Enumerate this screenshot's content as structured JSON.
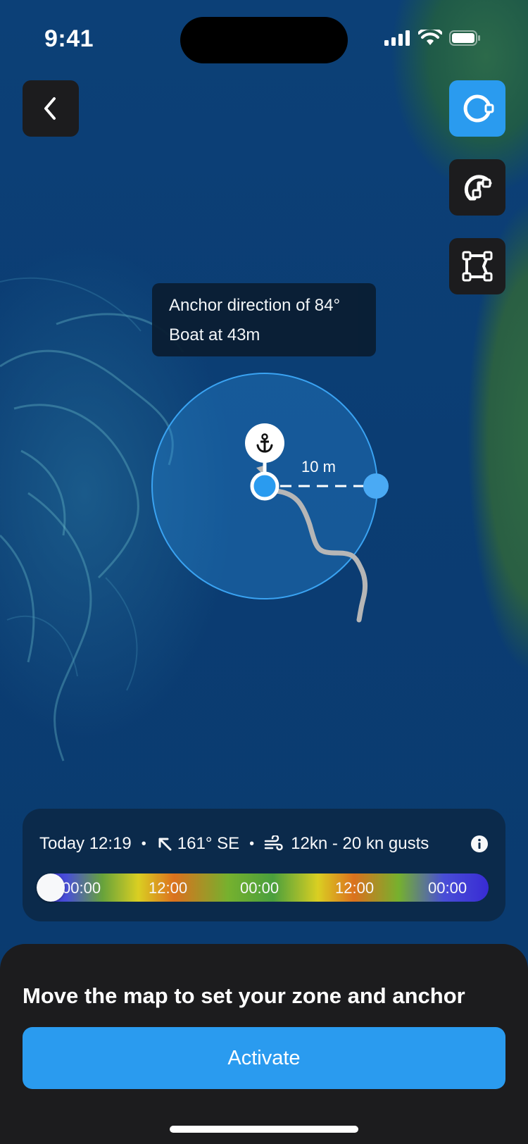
{
  "status_bar": {
    "time": "9:41"
  },
  "toolbar": {
    "back_icon": "chevron-left-icon",
    "tools": [
      {
        "name": "circle-zone-tool",
        "icon": "circle-zone-icon",
        "active": true
      },
      {
        "name": "sector-zone-tool",
        "icon": "sector-zone-icon",
        "active": false
      },
      {
        "name": "polygon-zone-tool",
        "icon": "polygon-zone-icon",
        "active": false
      }
    ]
  },
  "map": {
    "tooltip": {
      "line1": "Anchor direction of 84°",
      "line2": "Boat at 43m"
    },
    "radius_label": "10 m",
    "anchor_icon": "anchor-icon"
  },
  "weather": {
    "date_time": "Today 12:19",
    "wind_direction": "161° SE",
    "wind_speed": "12kn - 20 kn gusts",
    "timeline_ticks": [
      "00:00",
      "12:00",
      "00:00",
      "12:00",
      "00:00"
    ],
    "timeline_position": 0
  },
  "sheet": {
    "title": "Move the map to set your zone and anchor",
    "activate_label": "Activate"
  },
  "colors": {
    "accent": "#2a9bef",
    "panel": "#1c1c1e",
    "zone_fill": "#2a8fe0"
  }
}
